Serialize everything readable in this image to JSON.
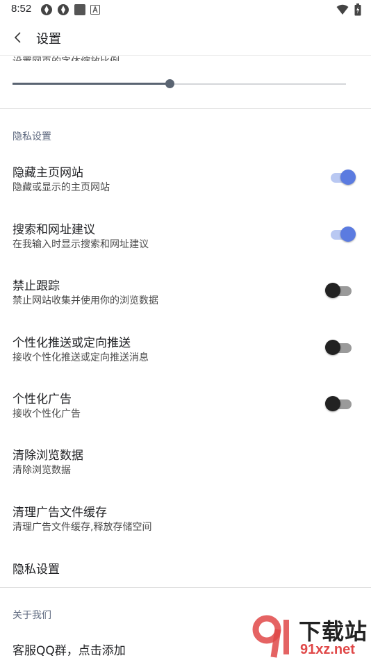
{
  "status_bar": {
    "time": "8:52",
    "left_icons": [
      "android-system-icon",
      "android-system-icon",
      "app-square-icon",
      "font-a-icon"
    ],
    "right_icons": [
      "wifi-icon",
      "battery-charging-icon"
    ]
  },
  "app_bar": {
    "title": "设置",
    "back_icon": "chevron-left-icon"
  },
  "font_scale": {
    "label_cut": "设置网页的字体缩放比例",
    "level": 0.47
  },
  "privacy": {
    "section_title": "隐私设置",
    "items": [
      {
        "title": "隐藏主页网站",
        "subtitle": "隐藏或显示的主页网站",
        "toggle": true
      },
      {
        "title": "搜索和网址建议",
        "subtitle": "在我输入时显示搜索和网址建议",
        "toggle": true
      },
      {
        "title": "禁止跟踪",
        "subtitle": "禁止网站收集并使用你的浏览数据",
        "toggle": false
      },
      {
        "title": "个性化推送或定向推送",
        "subtitle": "接收个性化推送或定向推送消息",
        "toggle": false
      },
      {
        "title": "个性化广告",
        "subtitle": "接收个性化广告",
        "toggle": false
      },
      {
        "title": "清除浏览数据",
        "subtitle": "清除浏览数据"
      },
      {
        "title": "清理广告文件缓存",
        "subtitle": "清理广告文件缓存,释放存储空间"
      },
      {
        "title": "隐私设置"
      }
    ]
  },
  "about": {
    "section_title": "关于我们",
    "items": [
      {
        "title": "客服QQ群，点击添加"
      }
    ]
  },
  "watermark": {
    "main_text": "下载站",
    "url_text": "91xz.net"
  },
  "colors": {
    "accent": "#5b7be0",
    "section_header": "#5f6a80",
    "slider": "#5a6472"
  }
}
